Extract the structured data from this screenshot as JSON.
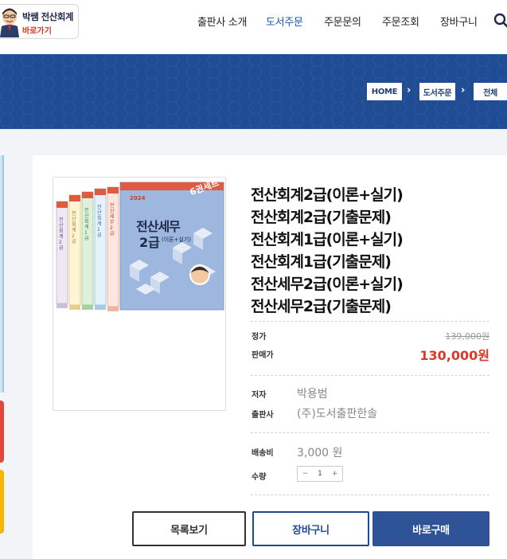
{
  "logo": {
    "line1": "박쌤 전산회계",
    "line2": "바로가기"
  },
  "nav": {
    "items": [
      {
        "label": "출판사 소개",
        "active": false
      },
      {
        "label": "도서주문",
        "active": true
      },
      {
        "label": "주문문의",
        "active": false
      },
      {
        "label": "주문조회",
        "active": false
      },
      {
        "label": "장바구니",
        "active": false
      }
    ],
    "search_icon": "search-icon"
  },
  "breadcrumb": [
    "HOME",
    "도서주문",
    "전체"
  ],
  "colors": {
    "accent": "#1d58a6",
    "banner": "#1f4c93",
    "sale": "#d63a2b",
    "buy": "#2e5497"
  },
  "cover": {
    "badge": "6권세트",
    "front_title": "전산세무",
    "front_grade": "2급",
    "front_sub": "(이론+실기)",
    "year": "2024",
    "spines": [
      "전산회계 2급",
      "전산회계 2급",
      "전산회계 1급",
      "전산회계 1급",
      "전산세무 2급"
    ]
  },
  "product": {
    "title_lines": [
      "전산회계2급(이론+실기)",
      "전산회계2급(기출문제)",
      "전산회계1급(이론+실기)",
      "전산회계1급(기출문제)",
      "전산세무2급(이론+실기)",
      "전산세무2급(기출문제)"
    ],
    "list_price_label": "정가",
    "list_price": "139,000원",
    "sale_price_label": "판매가",
    "sale_price": "130,000원",
    "author_label": "저자",
    "author": "박용범",
    "publisher_label": "출판사",
    "publisher": "(주)도서출판한솔",
    "shipping_label": "배송비",
    "shipping": "3,000 원",
    "qty_label": "수량",
    "qty": "1",
    "minus": "−",
    "plus": "+"
  },
  "buttons": {
    "list": "목록보기",
    "cart": "장바구니",
    "buy": "바로구매"
  }
}
